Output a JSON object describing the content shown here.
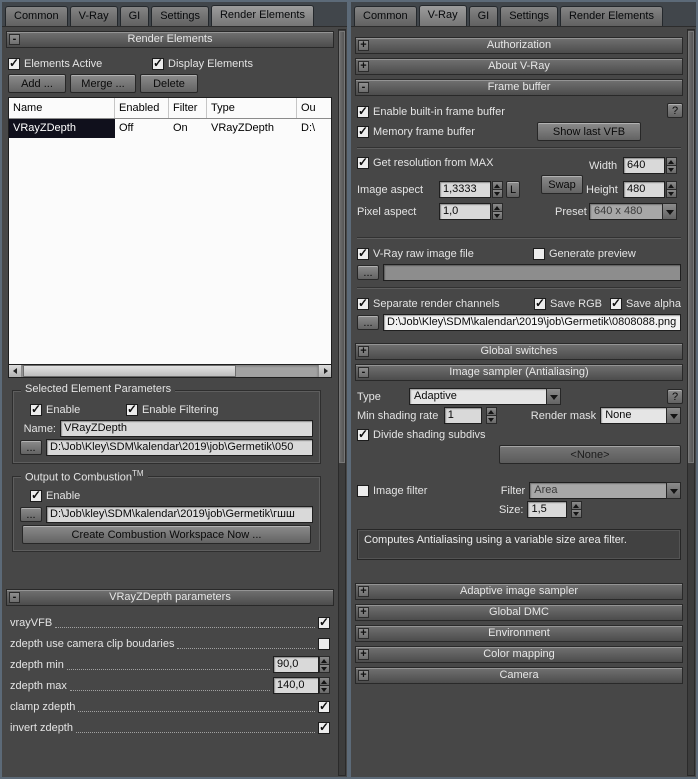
{
  "ui": {
    "minus": "-",
    "plus": "+",
    "help": "?",
    "browse": "..."
  },
  "tabs": [
    "Common",
    "V-Ray",
    "GI",
    "Settings",
    "Render Elements"
  ],
  "left": {
    "render_elements": {
      "title": "Render Elements",
      "elements_active": "Elements Active",
      "elements_active_checked": true,
      "display_elements": "Display Elements",
      "display_elements_checked": true,
      "add": "Add ...",
      "merge": "Merge ...",
      "delete": "Delete",
      "columns": [
        "Name",
        "Enabled",
        "Filter",
        "Type",
        "Ou"
      ],
      "row": {
        "name": "VRayZDepth",
        "enabled": "Off",
        "filter": "On",
        "type": "VRayZDepth",
        "output": "D:\\"
      }
    },
    "selected_params": {
      "title": "Selected Element Parameters",
      "enable": "Enable",
      "enable_checked": true,
      "enable_filtering": "Enable Filtering",
      "enable_filtering_checked": true,
      "name_label": "Name:",
      "name_value": "VRayZDepth",
      "path": "D:\\Job\\Kley\\SDM\\kalendar\\2019\\job\\Germetik\\050"
    },
    "combustion": {
      "title": "Output to Combustion",
      "tm": "TM",
      "enable": "Enable",
      "enable_checked": true,
      "path": "D:\\Job\\kley\\SDM\\kalendar\\2019\\job\\Germetik\\гшш",
      "create": "Create Combustion Workspace Now ..."
    },
    "zdepth": {
      "title": "VRayZDepth parameters",
      "rows": [
        {
          "label": "vrayVFB",
          "checked": true
        },
        {
          "label": "zdepth use camera clip boudaries",
          "checked": false
        },
        {
          "label": "zdepth min",
          "value": "90,0"
        },
        {
          "label": "zdepth max",
          "value": "140,0"
        },
        {
          "label": "clamp zdepth",
          "checked": true
        },
        {
          "label": "invert zdepth",
          "checked": true
        }
      ]
    }
  },
  "right": {
    "rollouts_top": [
      "Authorization",
      "About V-Ray"
    ],
    "frame_buffer": {
      "title": "Frame buffer",
      "enable_builtin": "Enable built-in frame buffer",
      "enable_builtin_checked": true,
      "memory_fb": "Memory frame buffer",
      "memory_fb_checked": true,
      "show_last_vfb": "Show last VFB",
      "get_resolution": "Get resolution from MAX",
      "get_resolution_checked": true,
      "image_aspect_label": "Image aspect",
      "image_aspect": "1,3333",
      "lock_button": "L",
      "pixel_aspect_label": "Pixel aspect",
      "pixel_aspect": "1,0",
      "swap": "Swap",
      "width_label": "Width",
      "width": "640",
      "height_label": "Height",
      "height": "480",
      "preset_label": "Preset",
      "preset": "640 x 480",
      "raw_file": "V-Ray raw image file",
      "raw_file_checked": true,
      "generate_preview": "Generate preview",
      "generate_preview_checked": false,
      "raw_path": "",
      "separate_channels": "Separate render channels",
      "separate_channels_checked": true,
      "save_rgb": "Save RGB",
      "save_rgb_checked": true,
      "save_alpha": "Save alpha",
      "save_alpha_checked": true,
      "channels_path": "D:\\Job\\Kley\\SDM\\kalendar\\2019\\job\\Germetik\\0808088.png"
    },
    "global_switches": "Global switches",
    "image_sampler": {
      "title": "Image sampler (Antialiasing)",
      "type_label": "Type",
      "type_value": "Adaptive",
      "min_shading_label": "Min shading rate",
      "min_shading": "1",
      "render_mask_label": "Render mask",
      "render_mask": "None",
      "divide_label": "Divide shading subdivs",
      "divide_checked": true,
      "none_button": "<None>",
      "image_filter_label": "Image filter",
      "image_filter_checked": false,
      "filter_label": "Filter",
      "filter_value": "Area",
      "size_label": "Size:",
      "size_value": "1,5",
      "info": "Computes Antialiasing using a variable size area filter."
    },
    "rollouts_bottom": [
      "Adaptive image sampler",
      "Global DMC",
      "Environment",
      "Color mapping",
      "Camera"
    ]
  }
}
